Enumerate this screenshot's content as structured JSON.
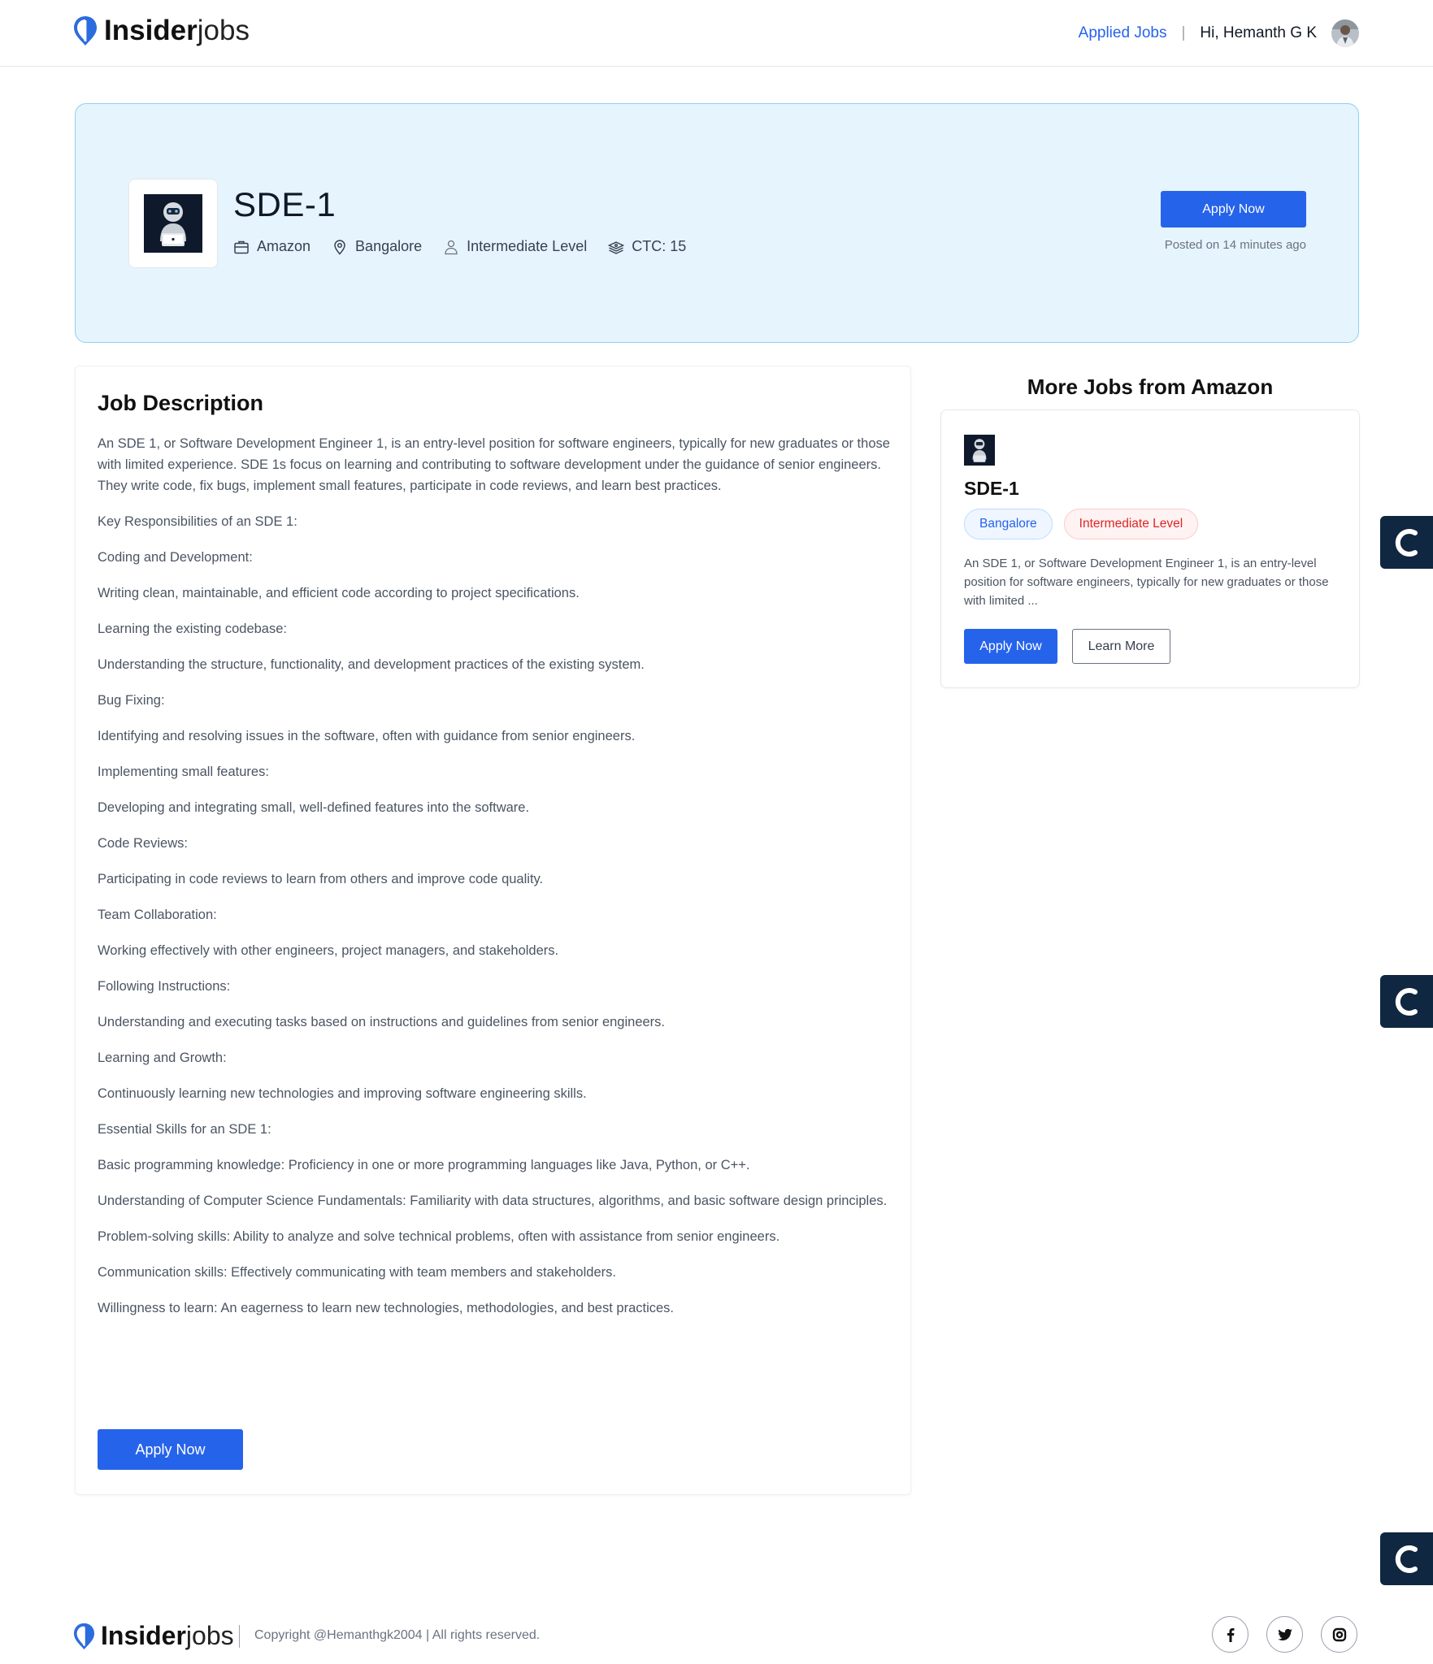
{
  "header": {
    "brand_strong": "Insider",
    "brand_light": "jobs",
    "applied_jobs_link": "Applied Jobs",
    "separator": "|",
    "greeting": "Hi, Hemanth G K"
  },
  "hero": {
    "title": "SDE-1",
    "company": "Amazon",
    "location": "Bangalore",
    "level": "Intermediate Level",
    "ctc": "CTC: 15",
    "apply_label": "Apply Now",
    "posted": "Posted on 14 minutes ago"
  },
  "description": {
    "heading": "Job Description",
    "paragraphs": [
      "An SDE 1, or Software Development Engineer 1, is an entry-level position for software engineers, typically for new graduates or those with limited experience. SDE 1s focus on learning and contributing to software development under the guidance of senior engineers. They write code, fix bugs, implement small features, participate in code reviews, and learn best practices.",
      "Key Responsibilities of an SDE 1:",
      "Coding and Development:",
      "Writing clean, maintainable, and efficient code according to project specifications.",
      "Learning the existing codebase:",
      "Understanding the structure, functionality, and development practices of the existing system.",
      "Bug Fixing:",
      "Identifying and resolving issues in the software, often with guidance from senior engineers.",
      "Implementing small features:",
      "Developing and integrating small, well-defined features into the software.",
      "Code Reviews:",
      "Participating in code reviews to learn from others and improve code quality.",
      "Team Collaboration:",
      "Working effectively with other engineers, project managers, and stakeholders.",
      "Following Instructions:",
      "Understanding and executing tasks based on instructions and guidelines from senior engineers.",
      "Learning and Growth:",
      "Continuously learning new technologies and improving software engineering skills.",
      "Essential Skills for an SDE 1:",
      "Basic programming knowledge: Proficiency in one or more programming languages like Java, Python, or C++.",
      "Understanding of Computer Science Fundamentals: Familiarity with data structures, algorithms, and basic software design principles.",
      "Problem-solving skills: Ability to analyze and solve technical problems, often with assistance from senior engineers.",
      "Communication skills: Effectively communicating with team members and stakeholders.",
      "Willingness to learn: An eagerness to learn new technologies, methodologies, and best practices."
    ],
    "apply_label": "Apply Now"
  },
  "more_jobs": {
    "heading": "More Jobs from Amazon",
    "card": {
      "title": "SDE-1",
      "location_tag": "Bangalore",
      "level_tag": "Intermediate Level",
      "excerpt": "An SDE 1, or Software Development Engineer 1, is an entry-level position for software engineers, typically for new graduates or those with limited ...",
      "apply_label": "Apply Now",
      "learn_label": "Learn More"
    }
  },
  "footer": {
    "brand_strong": "Insider",
    "brand_light": "jobs",
    "copyright": "Copyright @Hemanthgk2004 | All rights reserved."
  },
  "icons": {
    "logo": "insiderjobs-logo-icon",
    "company": "briefcase-icon",
    "location": "map-pin-icon",
    "level": "person-icon",
    "ctc": "money-stack-icon",
    "social": [
      "facebook-icon",
      "twitter-icon",
      "instagram-icon"
    ],
    "floating_widget": "c-logo-icon"
  },
  "colors": {
    "accent": "#2563eb",
    "hero_bg": "#e6f4fd",
    "hero_border": "#8dd1ee",
    "tag_red": "#dc2626",
    "widget_bg": "#0f2740"
  }
}
